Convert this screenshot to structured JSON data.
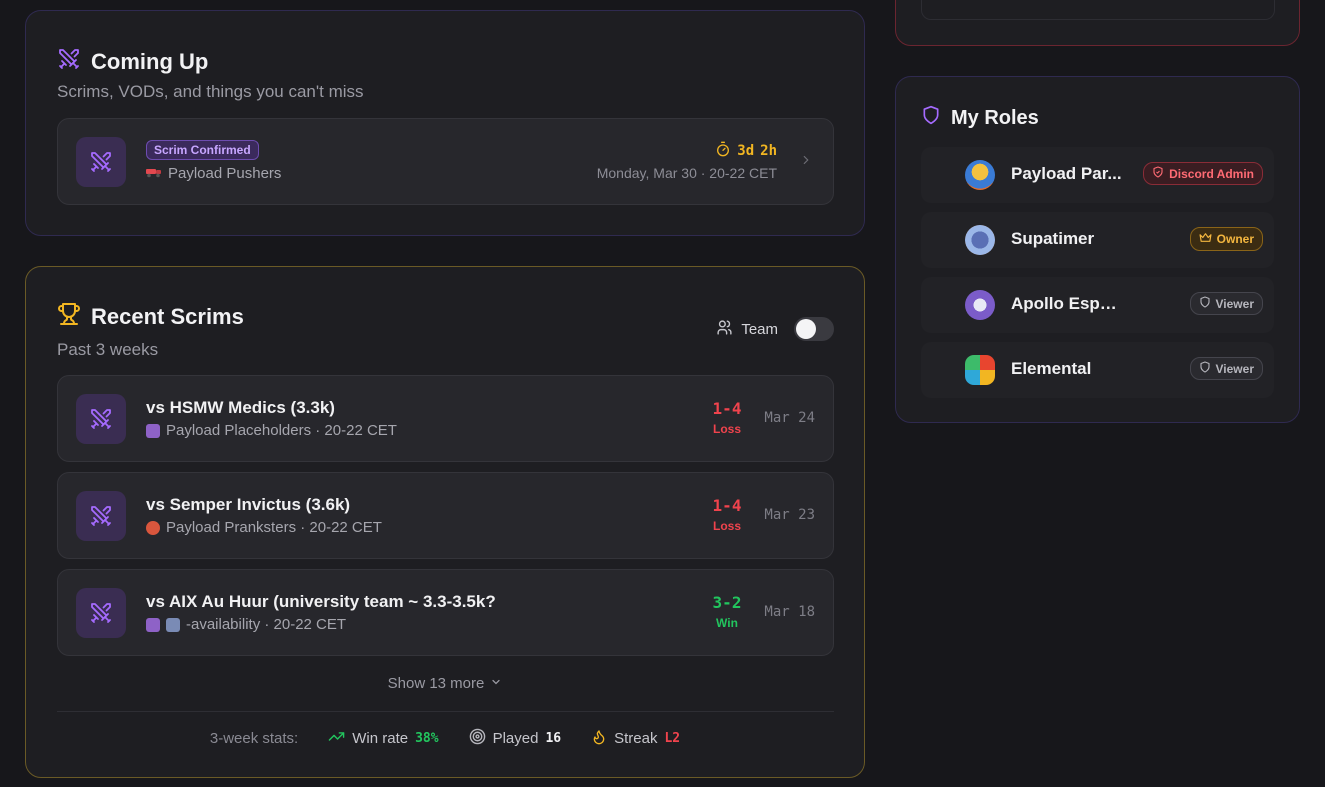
{
  "coming_up": {
    "title": "Coming Up",
    "subtitle": "Scrims, VODs, and things you can't miss",
    "item": {
      "badge": "Scrim Confirmed",
      "team": "Payload Pushers",
      "countdown_days": "3d",
      "countdown_hours": "2h",
      "datetime": "Monday, Mar 30 · 20-22 CET"
    }
  },
  "recent": {
    "title": "Recent Scrims",
    "subtitle": "Past 3 weeks",
    "toggle_label": "Team",
    "scrims": [
      {
        "title": "vs HSMW Medics (3.3k)",
        "sub": "Payload Placeholders · 20-22 CET",
        "score": "1-4",
        "result": "Loss",
        "date": "Mar 24"
      },
      {
        "title": "vs Semper Invictus (3.6k)",
        "sub": "Payload Pranksters · 20-22 CET",
        "score": "1-4",
        "result": "Loss",
        "date": "Mar 23"
      },
      {
        "title": "vs AIX Au Huur (university team ~ 3.3-3.5k?",
        "sub": "-availability · 20-22 CET",
        "score": "3-2",
        "result": "Win",
        "date": "Mar 18"
      }
    ],
    "show_more": "Show 13 more",
    "stats": {
      "label": "3-week stats:",
      "win_rate_label": "Win rate",
      "win_rate": "38%",
      "played_label": "Played",
      "played": "16",
      "streak_label": "Streak",
      "streak": "L2"
    }
  },
  "roles": {
    "title": "My Roles",
    "items": [
      {
        "name": "Payload Par...",
        "badge": "Discord Admin"
      },
      {
        "name": "Supatimer",
        "badge": "Owner"
      },
      {
        "name": "Apollo Esports",
        "badge": "Viewer"
      },
      {
        "name": "Elemental",
        "badge": "Viewer"
      }
    ]
  },
  "colors": {
    "accent_purple": "#a56bff",
    "gold": "#f2b622",
    "loss": "#f0434d",
    "win": "#22c55e"
  }
}
